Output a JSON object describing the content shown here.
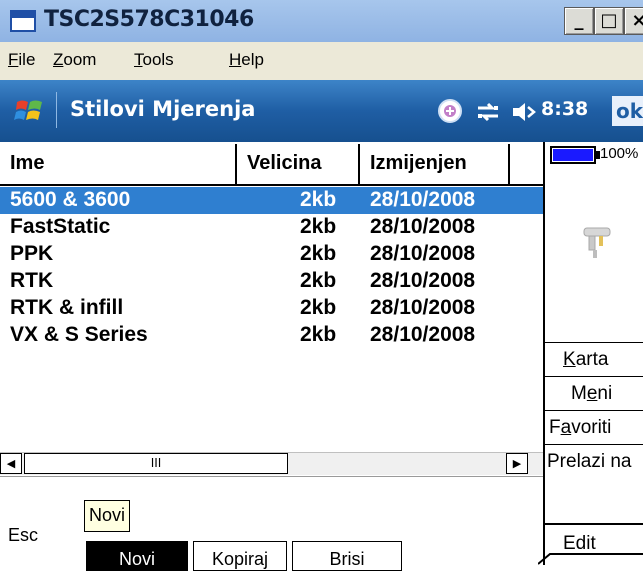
{
  "window": {
    "title": "TSC2S578C31046",
    "controls": {
      "minimize": "_",
      "maximize": "□",
      "close": "×"
    }
  },
  "menu": {
    "file": {
      "prefix": "",
      "mnemonic": "F",
      "rest": "ile"
    },
    "zoom": {
      "prefix": "",
      "mnemonic": "Z",
      "rest": "oom"
    },
    "tools": {
      "prefix": "",
      "mnemonic": "T",
      "rest": "ools"
    },
    "help": {
      "prefix": "",
      "mnemonic": "H",
      "rest": "elp"
    }
  },
  "nav": {
    "title": "Stilovi Mjerenja",
    "time": "8:38",
    "ok": "ok",
    "icons": [
      "windows-flag-icon",
      "gps-status-icon",
      "connectivity-icon",
      "speaker-icon"
    ]
  },
  "list": {
    "headers": [
      "Ime",
      "Velicina",
      "Izmijenjen",
      ""
    ],
    "rows": [
      {
        "name": "5600 & 3600",
        "size": "2kb",
        "modified": "28/10/2008",
        "selected": true
      },
      {
        "name": "FastStatic",
        "size": "2kb",
        "modified": "28/10/2008",
        "selected": false
      },
      {
        "name": "PPK",
        "size": "2kb",
        "modified": "28/10/2008",
        "selected": false
      },
      {
        "name": "RTK",
        "size": "2kb",
        "modified": "28/10/2008",
        "selected": false
      },
      {
        "name": "RTK & infill",
        "size": "2kb",
        "modified": "28/10/2008",
        "selected": false
      },
      {
        "name": "VX & S Series",
        "size": "2kb",
        "modified": "28/10/2008",
        "selected": false
      }
    ],
    "scroll_thumb_glyph": "III"
  },
  "bottom": {
    "esc": "Esc",
    "tooltip": "Novi",
    "buttons": {
      "novi": "Novi",
      "kopiraj": "Kopiraj",
      "brisi": "Brisi"
    }
  },
  "right_panel": {
    "battery_pct": "100%",
    "karta": {
      "mnemonic": "K",
      "rest": "arta"
    },
    "meni": {
      "prefix": "M",
      "mnemonic": "e",
      "rest": "ni"
    },
    "favoriti": {
      "prefix": "F",
      "mnemonic": "a",
      "rest": "voriti"
    },
    "prelazi": "Prelazi na",
    "edit": "Edit"
  },
  "colors": {
    "selection": "#2f7fd0",
    "nav_bar": "#1f5ea4",
    "tooltip_bg": "#ffffe1",
    "battery": "#1a1aff"
  }
}
